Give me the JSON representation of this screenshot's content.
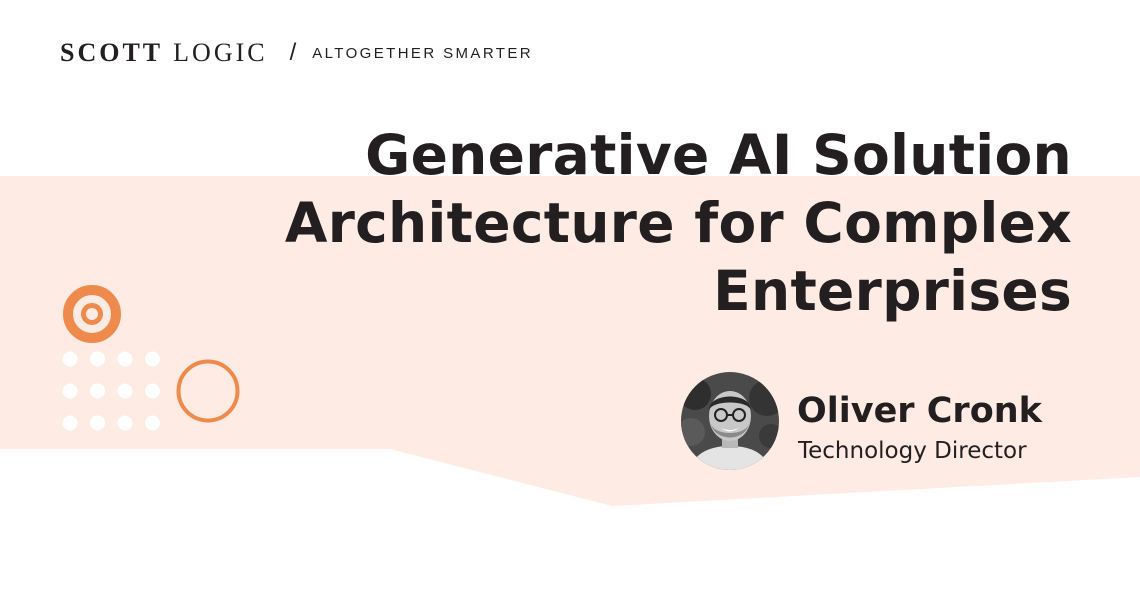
{
  "brand": {
    "name_primary": "SCOTT",
    "name_secondary": "LOGIC",
    "separator": "/",
    "tagline": "ALTOGETHER SMARTER"
  },
  "title": {
    "lines": [
      "Generative AI Solution",
      "Architecture for Complex",
      "Enterprises"
    ]
  },
  "speaker": {
    "name": "Oliver Cronk",
    "role": "Technology Director"
  },
  "colors": {
    "band": "#fdebe4",
    "accent": "#ee8a4c",
    "text": "#231f20",
    "dots": "#ffffff"
  }
}
